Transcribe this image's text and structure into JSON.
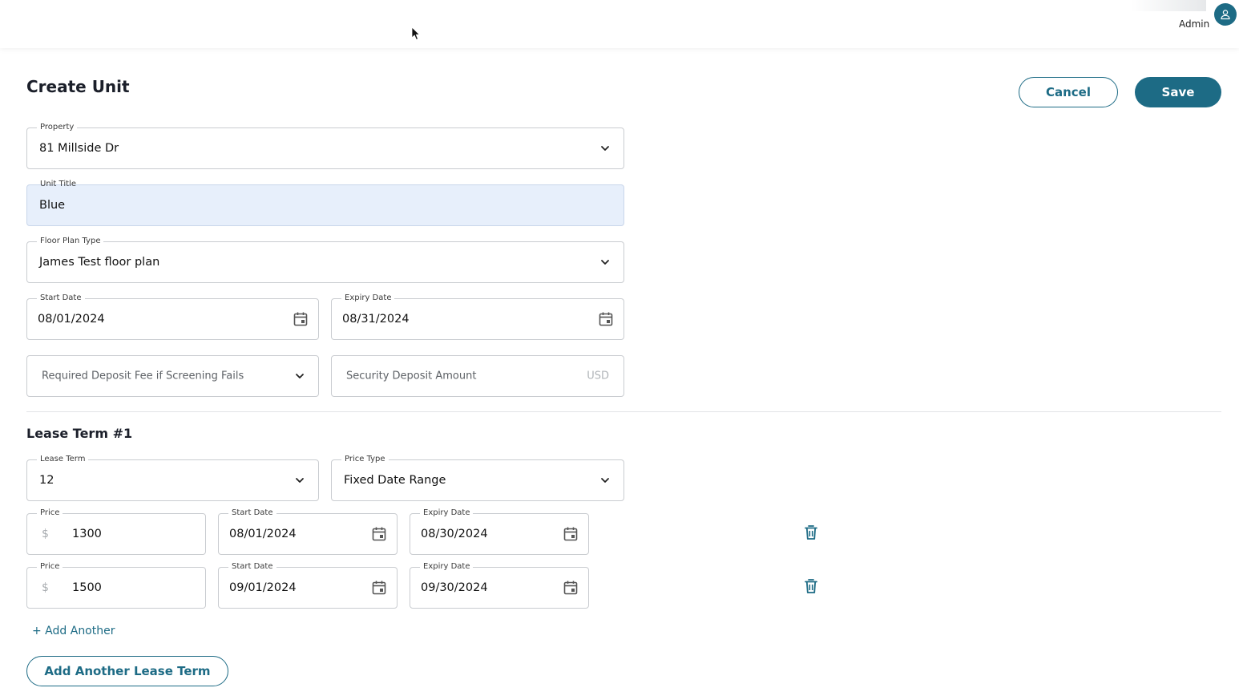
{
  "header": {
    "user_label": "Admin",
    "avatar_icon": "user-icon"
  },
  "page": {
    "title": "Create Unit"
  },
  "actions": {
    "cancel_label": "Cancel",
    "save_label": "Save"
  },
  "form": {
    "property": {
      "label": "Property",
      "value": "81 Millside Dr"
    },
    "unit_title": {
      "label": "Unit Title",
      "value": "Blue"
    },
    "floor_plan": {
      "label": "Floor Plan Type",
      "value": "James Test floor plan"
    },
    "start_date": {
      "label": "Start Date",
      "value": "08/01/2024"
    },
    "expiry_date": {
      "label": "Expiry Date",
      "value": "08/31/2024"
    },
    "deposit_fee": {
      "placeholder": "Required Deposit Fee if Screening Fails"
    },
    "security_deposit": {
      "placeholder": "Security Deposit Amount",
      "suffix": "USD"
    }
  },
  "lease_term": {
    "title": "Lease Term #1",
    "term": {
      "label": "Lease Term",
      "value": "12"
    },
    "price_type": {
      "label": "Price Type",
      "value": "Fixed Date Range"
    },
    "rows": [
      {
        "price_label": "Price",
        "currency": "$",
        "price": "1300",
        "start_label": "Start Date",
        "start": "08/01/2024",
        "expiry_label": "Expiry Date",
        "expiry": "08/30/2024"
      },
      {
        "price_label": "Price",
        "currency": "$",
        "price": "1500",
        "start_label": "Start Date",
        "start": "09/01/2024",
        "expiry_label": "Expiry Date",
        "expiry": "09/30/2024"
      }
    ],
    "add_another_label": "+ Add Another"
  },
  "add_lease_term_label": "Add Another Lease Term",
  "colors": {
    "accent": "#1d6b85",
    "field_highlight": "#e7effb",
    "border": "#c9ccd0"
  }
}
